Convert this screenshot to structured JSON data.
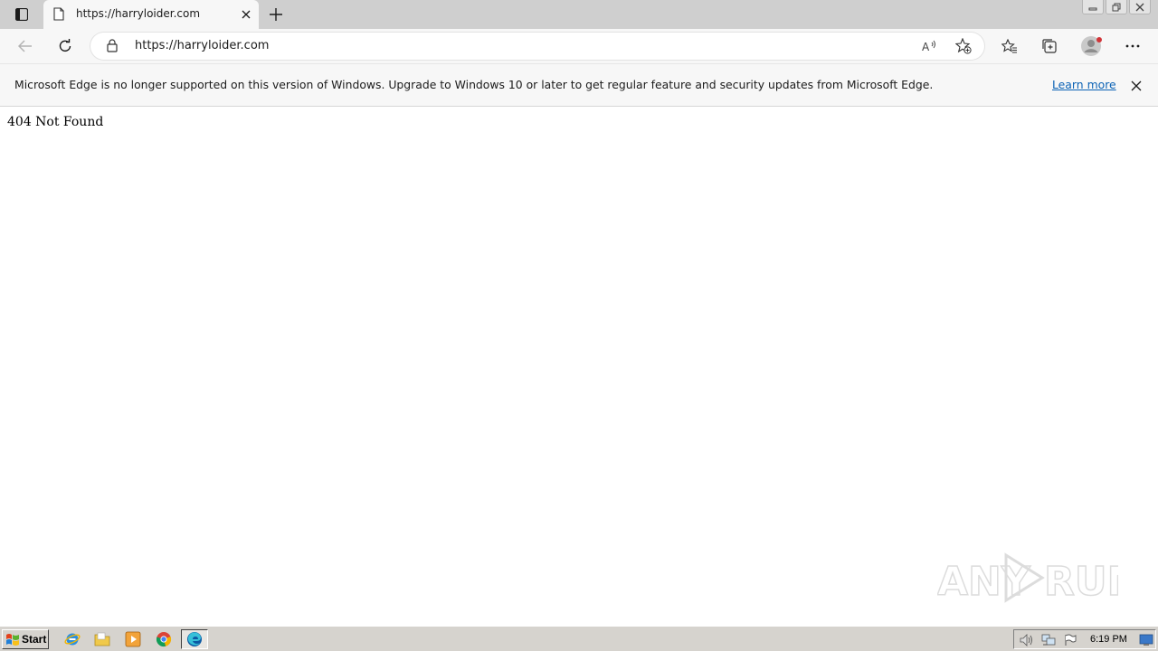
{
  "tab": {
    "title": "https://harryloider.com",
    "icons": {
      "page": "page-icon",
      "close": "close-icon"
    }
  },
  "toolbar": {
    "url": "https://harryloider.com",
    "icons": [
      "back-arrow-icon",
      "refresh-icon",
      "lock-icon",
      "read-aloud-icon",
      "add-favorite-icon",
      "favorites-icon",
      "collections-icon",
      "profile-avatar",
      "more-icon"
    ]
  },
  "infobar": {
    "message": "Microsoft Edge is no longer supported on this version of Windows. Upgrade to Windows 10 or later to get regular feature and security updates from Microsoft Edge.",
    "link": "Learn more"
  },
  "page": {
    "heading": "404 Not Found"
  },
  "watermark": {
    "left": "ANY",
    "right": "RUN"
  },
  "taskbar": {
    "start_label": "Start",
    "quick_launch": [
      "internet-explorer-icon",
      "folder-icon",
      "media-player-icon",
      "chrome-icon",
      "edge-icon"
    ],
    "clock": "6:19 PM"
  },
  "colors": {
    "tabstrip": "#cfcfcf",
    "toolbar": "#f7f7f7",
    "link": "#0b62b5",
    "taskbar": "#d6d3ce"
  }
}
